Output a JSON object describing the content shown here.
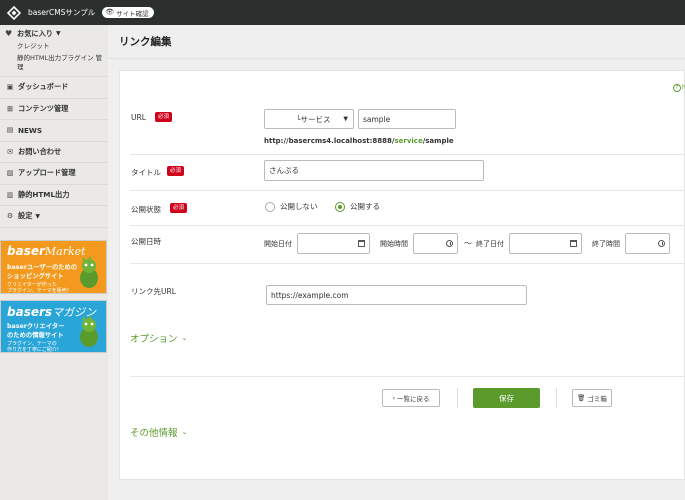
{
  "topbar": {
    "site_name": "baserCMSサンプル",
    "site_check": "サイト確認",
    "colors": {
      "bar": "#2b2f2d",
      "accent": "#5b9b2c",
      "required": "#d0021b"
    }
  },
  "sidebar": {
    "favorites": {
      "label": "お気に入り",
      "items": [
        "クレジット",
        "静的HTML出力プラグイン 管理"
      ]
    },
    "menu": [
      {
        "label": "ダッシュボード",
        "icon": "dashboard-icon"
      },
      {
        "label": "コンテンツ管理",
        "icon": "sitemap-icon"
      },
      {
        "label": "NEWS",
        "icon": "document-icon"
      },
      {
        "label": "お問い合わせ",
        "icon": "mail-icon"
      },
      {
        "label": "アップロード管理",
        "icon": "image-icon"
      },
      {
        "label": "静的HTML出力",
        "icon": "file-icon"
      },
      {
        "label": "設定",
        "icon": "gear-icon"
      }
    ],
    "banners": {
      "market": {
        "title": "baser",
        "title_sub": "Market",
        "line1": "baserユーザーのための",
        "line2": "ショッピングサイト",
        "small1": "クリエイターが作った",
        "small2": "プラグイン、テーマを販売！"
      },
      "magazine": {
        "title": "basers",
        "title_sub": "マガジン",
        "line1": "baserクリエイター",
        "line2": "のための情報サイト",
        "small1": "プラグイン、テーマの",
        "small2": "作り方を丁寧にご紹介!"
      }
    }
  },
  "page": {
    "title": "リンク編集",
    "help": "h"
  },
  "form": {
    "required_label": "必須",
    "url": {
      "label": "URL",
      "folder_select": "└サービス",
      "slug_value": "sample",
      "preview_prefix": "http://basercms4.localhost:8888/",
      "preview_highlight": "service",
      "preview_suffix": "/sample"
    },
    "title": {
      "label": "タイトル",
      "value": "さんぷる"
    },
    "status": {
      "label": "公開状態",
      "options": [
        "公開しない",
        "公開する"
      ],
      "selected": "公開する"
    },
    "publish_date": {
      "label": "公開日時",
      "start_date": "開始日付",
      "start_time": "開始時間",
      "tilde": "〜",
      "end_date": "終了日付",
      "end_time": "終了時間"
    },
    "link_url": {
      "label": "リンク先URL",
      "value": "https://example.com"
    },
    "options_toggle": "オプション",
    "other_info_toggle": "その他情報"
  },
  "actions": {
    "back": "一覧に戻る",
    "save": "保存",
    "trash": "ゴミ箱"
  }
}
